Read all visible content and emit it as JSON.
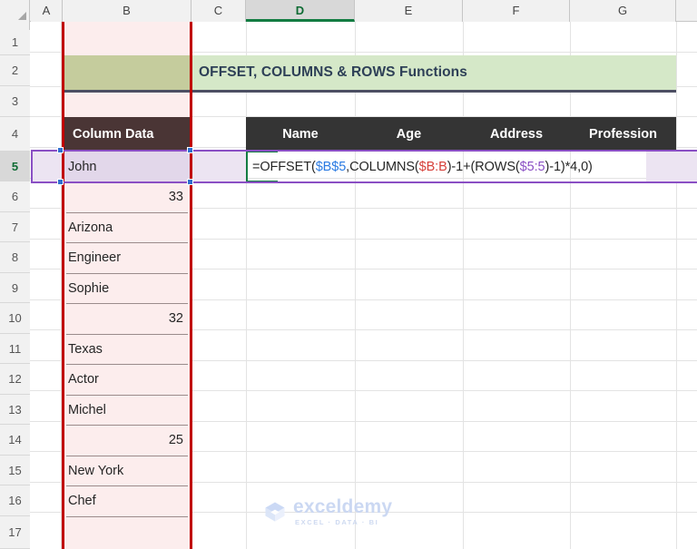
{
  "app": "excel-worksheet",
  "grid": {
    "column_headers": [
      "A",
      "B",
      "C",
      "D",
      "E",
      "F",
      "G"
    ],
    "active_column": "D",
    "active_row": "5",
    "row_headers": [
      "1",
      "2",
      "3",
      "4",
      "5",
      "6",
      "7",
      "8",
      "9",
      "10",
      "11",
      "12",
      "13",
      "14",
      "15",
      "16",
      "17"
    ]
  },
  "banner": {
    "title": "OFFSET, COLUMNS & ROWS Functions",
    "fill_b": "#c5cc9d",
    "fill_rest": "#d5e8c8",
    "text_color": "#2e4057"
  },
  "headers": {
    "column_data": "Column Data",
    "name": "Name",
    "age": "Age",
    "address": "Address",
    "profession": "Profession",
    "fill": "#343434",
    "fill_b": "#4a3535"
  },
  "column_data_values": [
    "John",
    "33",
    "Arizona",
    "Engineer",
    "Sophie",
    "32",
    "Texas",
    "Actor",
    "Michel",
    "25",
    "New York",
    "Chef",
    ""
  ],
  "column_data_align": [
    "text",
    "num",
    "text",
    "text",
    "text",
    "num",
    "text",
    "text",
    "text",
    "num",
    "text",
    "text",
    "text"
  ],
  "formula": {
    "full": "=OFFSET($B$5,COLUMNS($B:B)-1+(ROWS($5:5)-1)*4,0)",
    "tokens": [
      {
        "t": "=OFFSET(",
        "c": "plain"
      },
      {
        "t": "$B$5",
        "c": "blue"
      },
      {
        "t": ",COLUMNS(",
        "c": "plain"
      },
      {
        "t": "$B:B",
        "c": "red"
      },
      {
        "t": ")-1+(ROWS(",
        "c": "plain"
      },
      {
        "t": "$5:5",
        "c": "purple"
      },
      {
        "t": ")-1)*4,0)",
        "c": "plain"
      }
    ]
  },
  "selection": {
    "trace_color": "#8a4fc4",
    "handle_color": "#2f6fd0",
    "active_cell_border": "#137c42",
    "range_border": "#c00000"
  },
  "watermark": {
    "name": "exceldemy",
    "tagline": "EXCEL · DATA · BI"
  }
}
